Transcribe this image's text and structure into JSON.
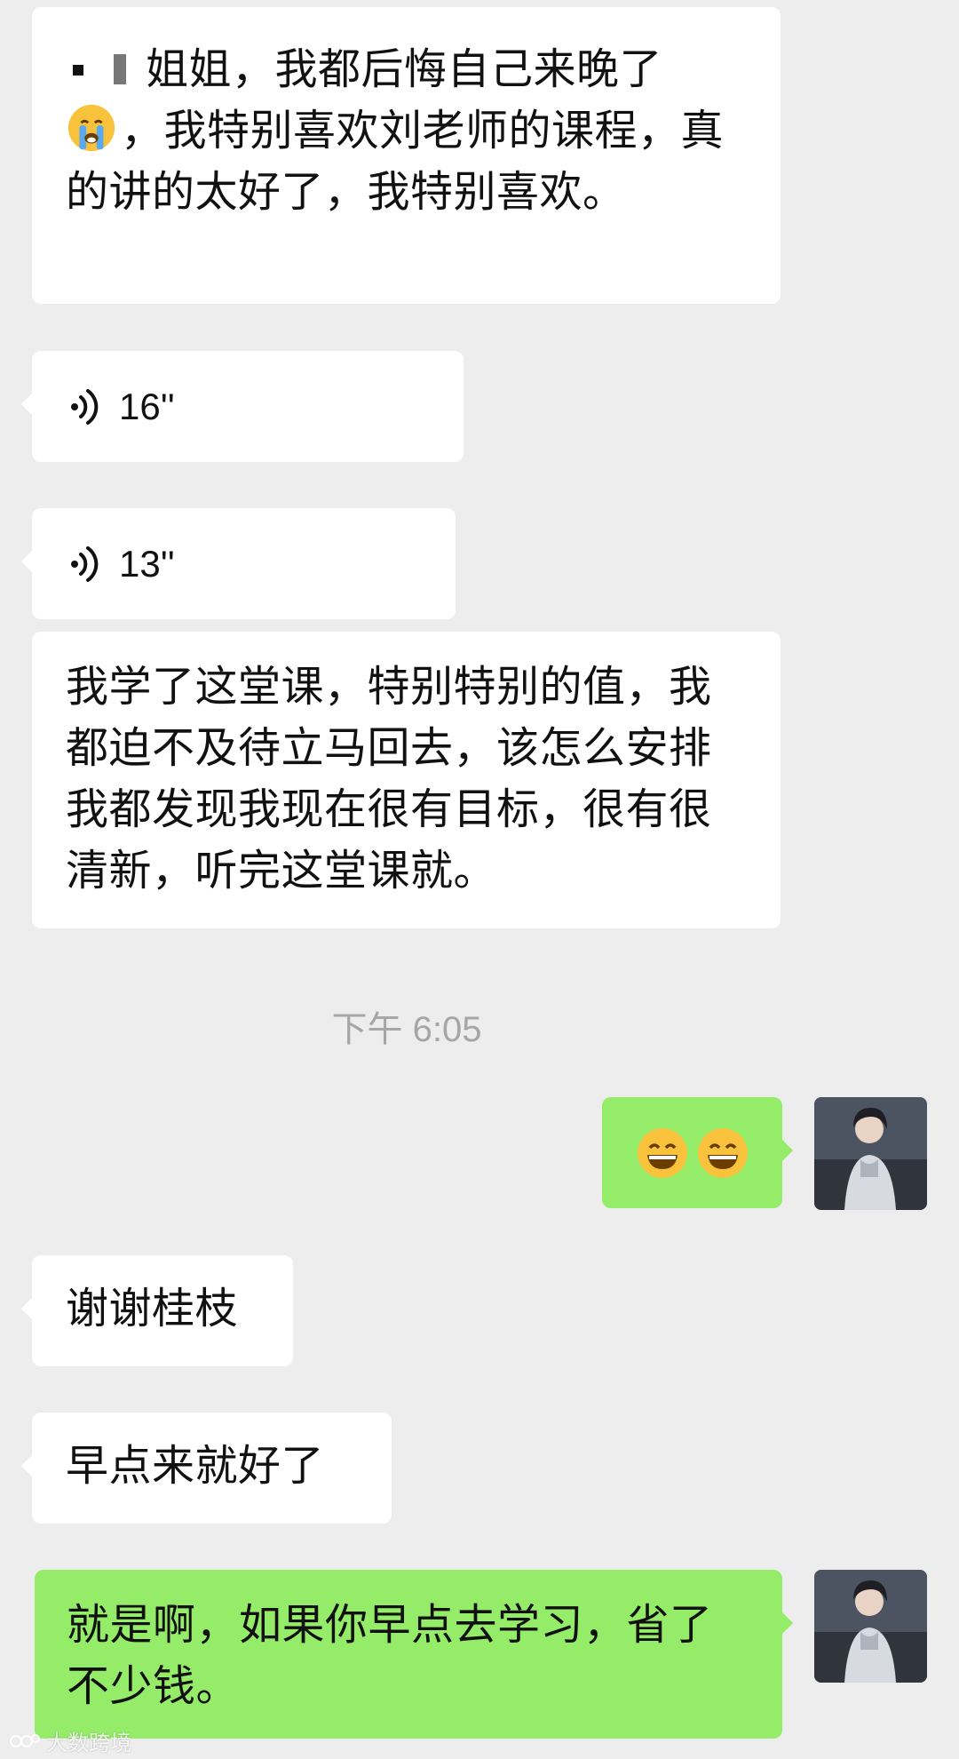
{
  "messages": [
    {
      "from": "contact",
      "type": "text",
      "redacted_prefix": true,
      "text_line1": "姐姐，我都后悔自己来晚了",
      "emoji": "crying-face",
      "text_rest": "，我特别喜欢刘老师的课程，真的讲的太好了，我特别喜欢。"
    },
    {
      "from": "contact",
      "type": "voice",
      "duration": "16''"
    },
    {
      "from": "contact",
      "type": "voice",
      "duration": "13''"
    },
    {
      "from": "contact",
      "type": "text",
      "text": "我学了这堂课，特别特别的值，我都迫不及待立马回去，该怎么安排我都发现我现在很有目标，很有很清新，听完这堂课就。"
    },
    {
      "from": "self",
      "type": "emoji",
      "emojis": [
        "grinning-face",
        "grinning-face"
      ]
    },
    {
      "from": "contact",
      "type": "text",
      "text": "谢谢桂枝"
    },
    {
      "from": "contact",
      "type": "text",
      "text": "早点来就好了"
    },
    {
      "from": "self",
      "type": "text",
      "text": "就是啊，如果你早点去学习，省了不少钱。"
    }
  ],
  "timestamp": "下午 6:05",
  "watermark": "大数跨境",
  "colors": {
    "background": "#ededed",
    "incoming_bubble": "#ffffff",
    "outgoing_bubble": "#95ec69",
    "timestamp_text": "#a6a6a6"
  }
}
